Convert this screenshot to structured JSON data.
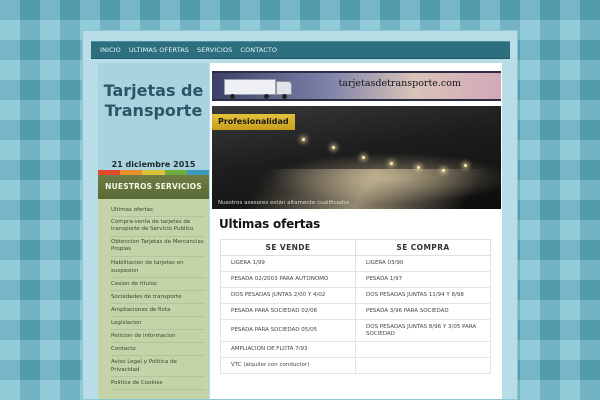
{
  "nav": [
    "INICIO",
    "ULTIMAS OFERTAS",
    "SERVICIOS",
    "CONTACTO"
  ],
  "site": {
    "title_line1": "Tarjetas de",
    "title_line2": "Transporte",
    "date": "21 diciembre 2015"
  },
  "strip_colors": [
    "#e04b2d",
    "#e8902b",
    "#d9c33c",
    "#6fae3e",
    "#3c9bb7"
  ],
  "services": {
    "header": "NUESTROS SERVICIOS",
    "items": [
      "Ultimas ofertas",
      "Compra-venta de tarjetas de transporte de Servicio Publico",
      "Obtencion Tarjetas de Mercancias Propias",
      "Habilitacion de tarjetas en suspesion",
      "Cesion de titulos",
      "Sociedades de transporte",
      "Ampliaciones de flota",
      "Legislacion",
      "Peticion de informacion",
      "Contacto",
      "Aviso Legal y Politica de Privacidad",
      "Politica de Cookies"
    ]
  },
  "banner": {
    "logo_text": "tarjetasdetransporte.com"
  },
  "hero": {
    "tag": "Profesionalidad",
    "caption": "Nuestros asesores están altamente cualificados"
  },
  "main": {
    "title": "Ultimas ofertas",
    "col_sell": "SE VENDE",
    "col_buy": "SE COMPRA",
    "rows": [
      [
        "LIGERA 1/99",
        "LIGERA 03/90"
      ],
      [
        "PESADA 02/2003 PARA AUTONOMO",
        "PESADA 1/97"
      ],
      [
        "DOS PESADAS JUNTAS 2/00 Y 4/02",
        "DOS PESADAS JUNTAS 11/94 Y 8/98"
      ],
      [
        "PESADA PARA SOCIEDAD 02/06",
        "PESADA 3/96 PARA SOCIEDAD"
      ],
      [
        "PESADA PARA SOCIEDAD 05/05",
        "DOS PESADAS JUNTAS 8/96 Y 3/05 PARA SOCIEDAD"
      ],
      [
        "AMPLIACION DE FLOTA 7/93",
        ""
      ],
      [
        "VTC (alquiler con conductor)",
        ""
      ]
    ]
  }
}
